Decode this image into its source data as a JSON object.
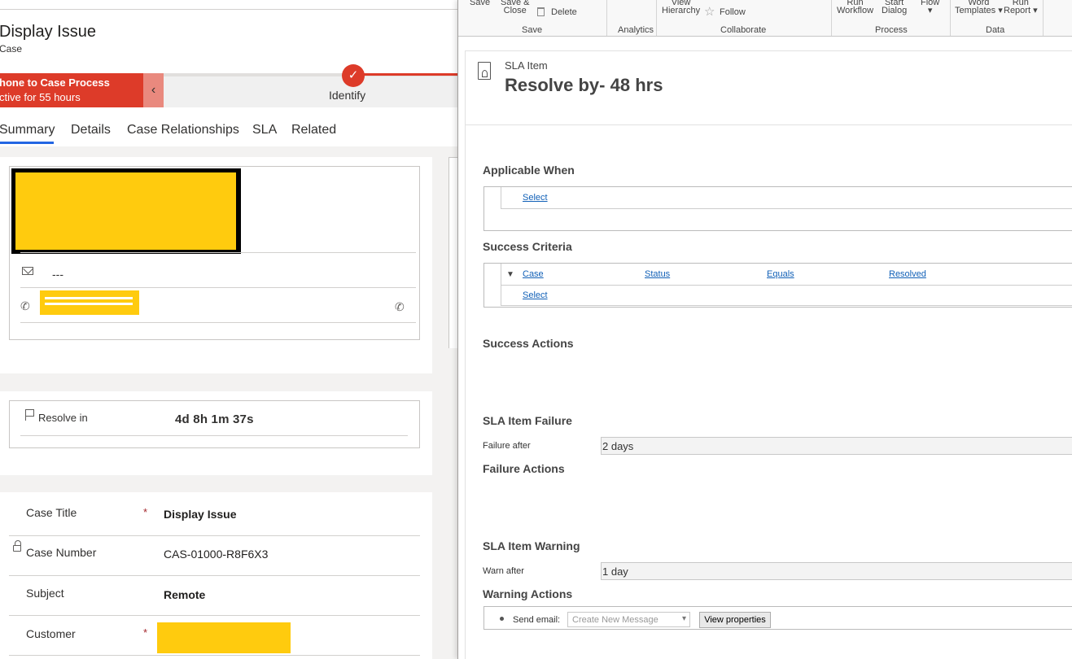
{
  "left": {
    "record_title": "Display Issue",
    "record_entity": "Case",
    "bpf": {
      "stage_name": "hone to Case Process",
      "stage_duration": "ctive for 55 hours",
      "collapse_glyph": "‹",
      "node_check": "✓",
      "node_label": "Identify"
    },
    "tabs": [
      "Summary",
      "Details",
      "Case Relationships",
      "SLA",
      "Related"
    ],
    "contact": {
      "email_value": "---",
      "phone_glyph": "✆"
    },
    "timer": {
      "label": "Resolve in",
      "value": "4d 8h 1m 37s"
    },
    "fields": [
      {
        "label": "Case Title",
        "required": "*",
        "value": "Display Issue"
      },
      {
        "label": "Case Number",
        "required": "",
        "value": "CAS-01000-R8F6X3"
      },
      {
        "label": "Subject",
        "required": "",
        "value": "Remote"
      },
      {
        "label": "Customer",
        "required": "*",
        "value": ""
      }
    ],
    "redaction_color": "#ffcb0e",
    "accent_red": "#dd3b29"
  },
  "ribbon": {
    "save": "Save",
    "save_close_1": "Save &",
    "save_close_2": "Close",
    "delete": "Delete",
    "group_save": "Save",
    "group_analytics": "Analytics",
    "view_1": "View",
    "view_2": "Hierarchy",
    "follow": "Follow",
    "group_collaborate": "Collaborate",
    "run_wf_1": "Run",
    "run_wf_2": "Workflow",
    "start_dlg_1": "Start",
    "start_dlg_2": "Dialog",
    "flow": "Flow",
    "flow_arrow": "▾",
    "group_process": "Process",
    "word_1": "Word",
    "word_2": "Templates ▾",
    "run_report_1": "Run",
    "run_report_2": "Report ▾",
    "group_data": "Data"
  },
  "sla": {
    "entity": "SLA Item",
    "title": "Resolve by- 48 hrs",
    "applicable_when": {
      "heading": "Applicable When",
      "select_link": "Select"
    },
    "success_criteria": {
      "heading": "Success Criteria",
      "condition": {
        "chevron": "▼",
        "entity": "Case",
        "field": "Status",
        "operator": "Equals",
        "value": "Resolved"
      },
      "select_link": "Select"
    },
    "success_actions": {
      "heading": "Success Actions"
    },
    "failure": {
      "heading": "SLA Item Failure",
      "label": "Failure after",
      "value": "2 days"
    },
    "failure_actions": {
      "heading": "Failure Actions"
    },
    "warning": {
      "heading": "SLA Item Warning",
      "label": "Warn after",
      "value": "1 day"
    },
    "warning_actions": {
      "heading": "Warning Actions",
      "step_label": "Send email:",
      "select_placeholder": "Create New Message",
      "select_arrow": "▾",
      "view_properties": "View properties"
    },
    "link_color": "#1160b7"
  }
}
